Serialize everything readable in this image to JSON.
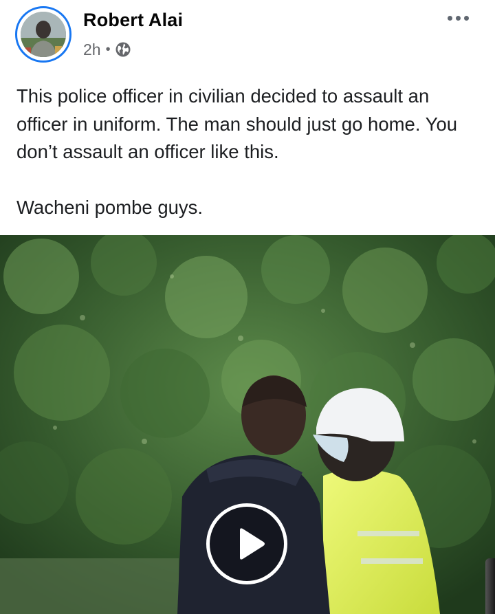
{
  "post": {
    "author": "Robert Alai",
    "timestamp": "2h",
    "separator": "•",
    "privacy_icon": "globe-icon",
    "more_icon": "more-options-icon",
    "caption_lines": [
      "This police officer in civilian decided to assault an officer in uniform. The man should just go home. You don’t assault an officer like this.",
      "Wacheni pombe guys."
    ],
    "media": {
      "type": "video",
      "play_icon": "play-icon"
    }
  },
  "colors": {
    "accent": "#1877f2",
    "name_text": "#050505",
    "meta_text": "#65676b",
    "body_text": "#1c1e21"
  }
}
